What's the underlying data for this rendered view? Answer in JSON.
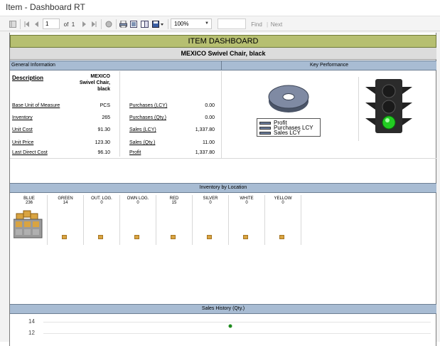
{
  "window": {
    "title": "Item - Dashboard RT"
  },
  "toolbar": {
    "page_current": "1",
    "page_of": "of",
    "page_total": "1",
    "zoom": "100%",
    "find": "Find",
    "next": "Next"
  },
  "report": {
    "title": "ITEM DASHBOARD",
    "subtitle": "MEXICO Swivel Chair, black",
    "general_header": "General Information",
    "kpi_header": "Key Performance",
    "description_label": "Description",
    "description_value_1": "MEXICO",
    "description_value_2": "Swivel Chair,",
    "description_value_3": "black",
    "left_fields": [
      {
        "label": "Base Unit of Measure",
        "value": "PCS"
      },
      {
        "label": "Inventory",
        "value": "265"
      },
      {
        "label": "Unit Cost",
        "value": "91.30"
      },
      {
        "label": "Unit Price",
        "value": "123.30"
      },
      {
        "label": "Last Direct Cost",
        "value": "96.10"
      }
    ],
    "right_fields": [
      {
        "label": "Purchases (LCY)",
        "value": "0.00"
      },
      {
        "label": "Purchases (Qty.)",
        "value": "0.00"
      },
      {
        "label": "Sales (LCY)",
        "value": "1,337.80"
      },
      {
        "label": "Sales (Qty.)",
        "value": "11.00"
      },
      {
        "label": "Profit",
        "value": "1,337.80"
      }
    ],
    "legend": [
      "Profit",
      "Purchases LCY",
      "Sales LCY"
    ],
    "traffic_light": "green",
    "inventory_header": "Inventory by Location",
    "locations": [
      {
        "name": "BLUE",
        "count": "236"
      },
      {
        "name": "GREEN",
        "count": "14"
      },
      {
        "name": "OUT. LOG.",
        "count": "0"
      },
      {
        "name": "OWN LOG.",
        "count": "0"
      },
      {
        "name": "RED",
        "count": "15"
      },
      {
        "name": "SILVER",
        "count": "0"
      },
      {
        "name": "WHITE",
        "count": "0"
      },
      {
        "name": "YELLOW",
        "count": "0"
      }
    ],
    "sales_header": "Sales History (Qty.)",
    "sales_axis": [
      "14",
      "12"
    ]
  },
  "colors": {
    "title_bar": "#b6bf71",
    "section_header": "#a8bcd3",
    "light_green": "#22cc22",
    "legend_swatch": "#6c7fa0"
  }
}
